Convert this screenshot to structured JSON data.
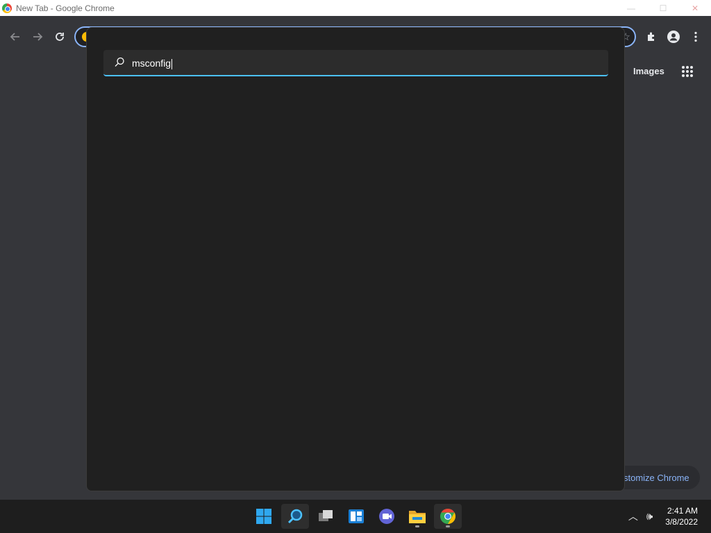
{
  "window": {
    "title": "New Tab - Google Chrome",
    "minimize": "—",
    "maximize": "☐",
    "close": "✕"
  },
  "toolbar": {
    "back_icon": "arrow-left-icon",
    "forward_icon": "arrow-right-icon",
    "reload_icon": "reload-icon",
    "extensions_icon": "puzzle-icon",
    "profile_icon": "profile-icon",
    "menu_icon": "kebab-menu-icon",
    "bookmark_icon": "star-icon"
  },
  "new_tab_page": {
    "images_link": "Images",
    "customize_button": "stomize Chrome"
  },
  "search": {
    "query": "msconfig"
  },
  "taskbar": {
    "apps": [
      "windows-start",
      "search",
      "task-view",
      "widgets",
      "teams-chat",
      "file-explorer",
      "chrome"
    ],
    "time": "2:41 AM",
    "date": "3/8/2022"
  },
  "colors": {
    "accent": "#4cc2ff",
    "chrome_focus": "#8ab4f8",
    "panel_bg": "#202020"
  }
}
